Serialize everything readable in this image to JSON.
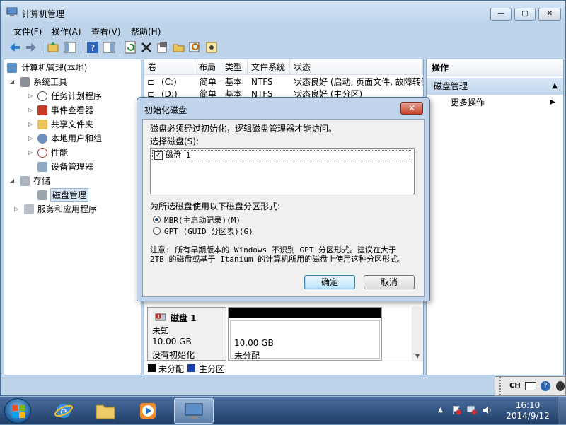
{
  "window": {
    "title": "计算机管理",
    "caption_min": "—",
    "caption_max": "▢",
    "caption_close": "✕"
  },
  "menu": [
    "文件(F)",
    "操作(A)",
    "查看(V)",
    "帮助(H)"
  ],
  "tree": {
    "root": "计算机管理(本地)",
    "system_tools": "系统工具",
    "task_scheduler": "任务计划程序",
    "event_viewer": "事件查看器",
    "shared_folders": "共享文件夹",
    "local_users": "本地用户和组",
    "performance": "性能",
    "device_manager": "设备管理器",
    "storage": "存储",
    "disk_management": "磁盘管理",
    "services_apps": "服务和应用程序"
  },
  "table": {
    "columns": [
      "卷",
      "布局",
      "类型",
      "文件系统",
      "状态"
    ],
    "rows": [
      {
        "vol": "(C:)",
        "layout": "简单",
        "type": "基本",
        "fs": "NTFS",
        "status": "状态良好 (启动, 页面文件, 故障转储"
      },
      {
        "vol": "(D:)",
        "layout": "简单",
        "type": "基本",
        "fs": "NTFS",
        "status": "状态良好 (主分区)"
      }
    ]
  },
  "actions": {
    "header": "操作",
    "section": "磁盘管理",
    "more": "更多操作",
    "section_arrow": "▲",
    "more_arrow": "▶"
  },
  "disk": {
    "name": "磁盘 1",
    "status": "未知",
    "size": "10.00 GB",
    "init_state": "没有初始化",
    "part_size": "10.00 GB",
    "part_state": "未分配"
  },
  "legend": {
    "unallocated": "未分配",
    "primary": "主分区",
    "unallocated_color": "#000000",
    "primary_color": "#1a3fa8"
  },
  "dialog": {
    "title": "初始化磁盘",
    "close": "✕",
    "intro": "磁盘必须经过初始化，逻辑磁盘管理器才能访问。",
    "select_label": "选择磁盘(S):",
    "disk_item": "磁盘 1",
    "disk_checked": true,
    "style_label": "为所选磁盘使用以下磁盘分区形式:",
    "mbr": "MBR(主启动记录)(M)",
    "gpt": "GPT (GUID 分区表)(G)",
    "selected": "mbr",
    "note": "注意: 所有早期版本的 Windows 不识别 GPT 分区形式。建议在大于 2TB 的磁盘或基于 Itanium 的计算机所用的磁盘上使用这种分区形式。",
    "ok": "确定",
    "cancel": "取消"
  },
  "tray": {
    "ime": "CH",
    "time": "16:10",
    "date": "2014/9/12"
  },
  "colors": {
    "titlebar": "#bcd3ea",
    "selection": "#d9e7f6",
    "unallocated_bar": "#000000"
  }
}
